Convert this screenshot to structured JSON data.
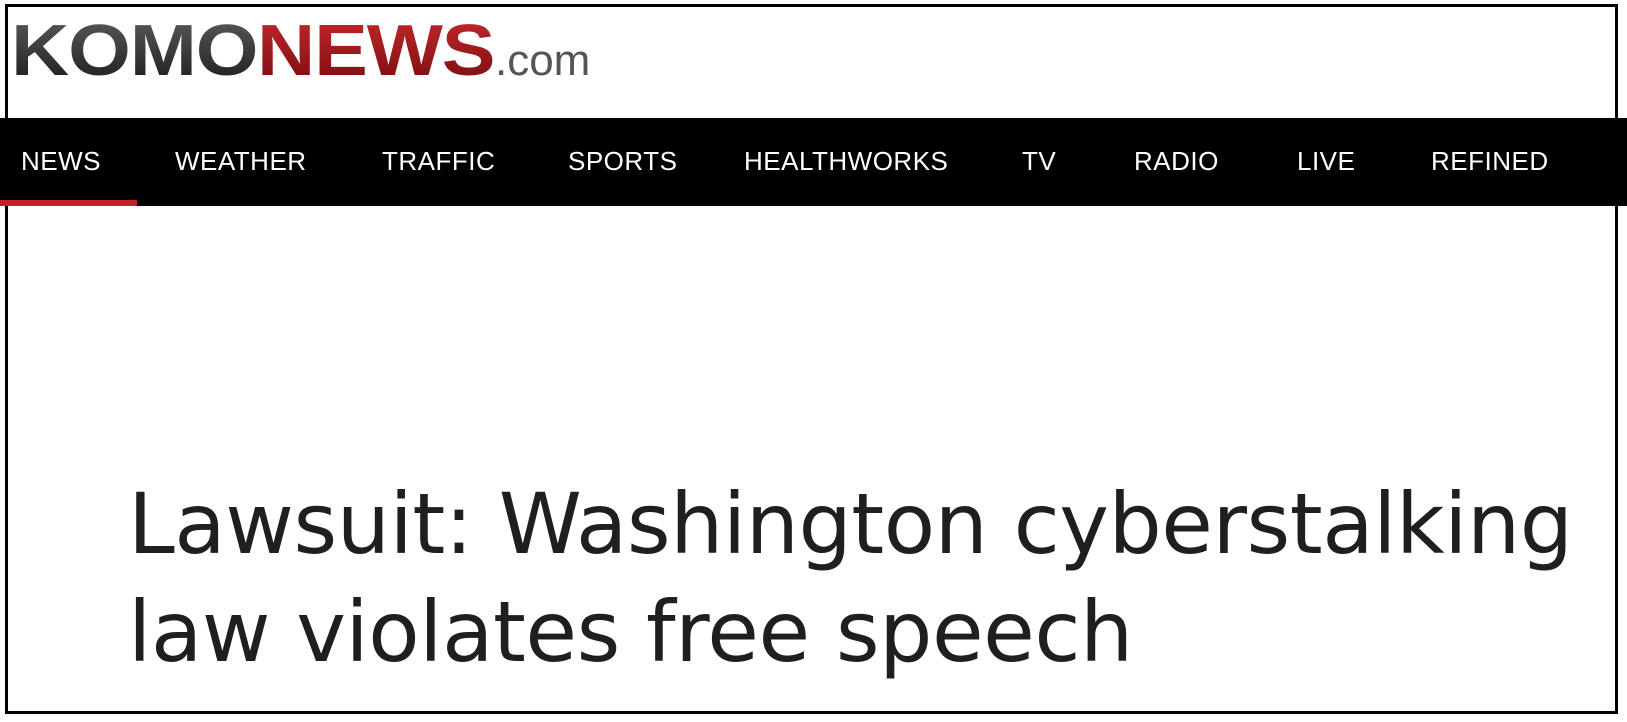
{
  "logo": {
    "part1": "KOMO",
    "part2": "NEWS",
    "part3": ".com",
    "colors": {
      "komo": "#2f2f2f",
      "news": "#9a1518",
      "dotcom": "#555555"
    }
  },
  "nav": {
    "items": [
      {
        "label": "NEWS",
        "active": true
      },
      {
        "label": "WEATHER"
      },
      {
        "label": "TRAFFIC"
      },
      {
        "label": "SPORTS"
      },
      {
        "label": "HEALTHWORKS"
      },
      {
        "label": "TV"
      },
      {
        "label": "RADIO"
      },
      {
        "label": "LIVE"
      },
      {
        "label": "REFINED"
      }
    ],
    "background": "#000000",
    "active_underline_color": "#c8202a"
  },
  "article": {
    "headline": "Lawsuit: Washington cyberstalking law violates free speech"
  }
}
